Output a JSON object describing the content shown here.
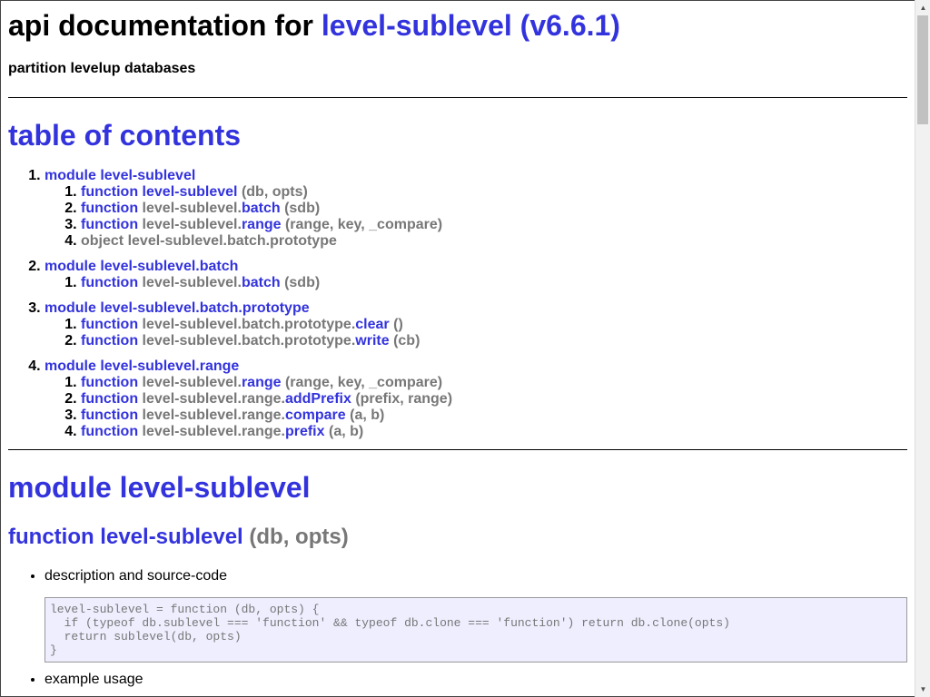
{
  "header": {
    "title_prefix": "api documentation for",
    "title_link": "level-sublevel (v6.6.1)",
    "subtitle": "partition levelup databases"
  },
  "toc": {
    "heading": "table of contents",
    "modules": [
      {
        "label": "module level-sublevel",
        "items": [
          {
            "kind": "function",
            "prefix": "level-sublevel",
            "name": "",
            "args": "(db, opts)",
            "name_first": true
          },
          {
            "kind": "function",
            "prefix": "level-sublevel.",
            "name": "batch",
            "args": "(sdb)"
          },
          {
            "kind": "function",
            "prefix": "level-sublevel.",
            "name": "range",
            "args": "(range, key, _compare)"
          },
          {
            "kind": "object",
            "prefix": "level-sublevel.batch.prototype",
            "name": "",
            "args": ""
          }
        ]
      },
      {
        "label": "module level-sublevel.batch",
        "items": [
          {
            "kind": "function",
            "prefix": "level-sublevel.",
            "name": "batch",
            "args": "(sdb)"
          }
        ]
      },
      {
        "label": "module level-sublevel.batch.prototype",
        "items": [
          {
            "kind": "function",
            "prefix": "level-sublevel.batch.prototype.",
            "name": "clear",
            "args": "()"
          },
          {
            "kind": "function",
            "prefix": "level-sublevel.batch.prototype.",
            "name": "write",
            "args": "(cb)"
          }
        ]
      },
      {
        "label": "module level-sublevel.range",
        "items": [
          {
            "kind": "function",
            "prefix": "level-sublevel.",
            "name": "range",
            "args": "(range, key, _compare)"
          },
          {
            "kind": "function",
            "prefix": "level-sublevel.range.",
            "name": "addPrefix",
            "args": "(prefix, range)"
          },
          {
            "kind": "function",
            "prefix": "level-sublevel.range.",
            "name": "compare",
            "args": "(a, b)"
          },
          {
            "kind": "function",
            "prefix": "level-sublevel.range.",
            "name": "prefix",
            "args": "(a, b)"
          }
        ]
      }
    ]
  },
  "section": {
    "module_heading": "module level-sublevel",
    "function_keyword": "function level-sublevel",
    "function_args": "(db, opts)",
    "bullets": [
      "description and source-code",
      "example usage"
    ],
    "code": "level-sublevel = function (db, opts) {\n  if (typeof db.sublevel === 'function' && typeof db.clone === 'function') return db.clone(opts)\n  return sublevel(db, opts)\n}"
  },
  "colors": {
    "link": "#3333dd",
    "muted": "#777777",
    "code_bg": "#eeeeff"
  }
}
